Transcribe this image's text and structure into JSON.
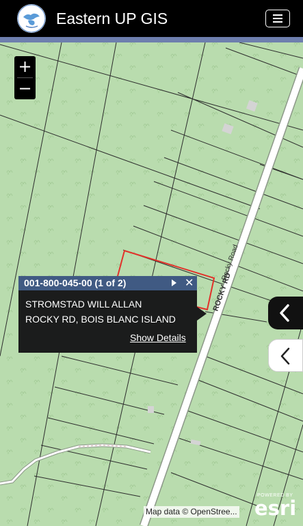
{
  "header": {
    "title": "Eastern UP GIS",
    "logo_icon": "regional-seal-logo",
    "menu_icon": "hamburger-menu-icon"
  },
  "zoom": {
    "in_label": "+",
    "out_label": "−"
  },
  "popup": {
    "title": "001-800-045-00 (1 of 2)",
    "owner": "STROMSTAD WILL ALLAN",
    "address": "ROCKY RD, BOIS BLANC ISLAND",
    "details_link": "Show Details",
    "close_label": "✕"
  },
  "map": {
    "road_label_primary": "ROCKY RD",
    "road_label_secondary": "Rocky Road",
    "attribution": "Map data © OpenStree...",
    "esri_powered": "POWERED BY",
    "esri_brand": "esri",
    "parcel_highlight_color": "#e2312a",
    "background_color": "#b9dcae"
  }
}
